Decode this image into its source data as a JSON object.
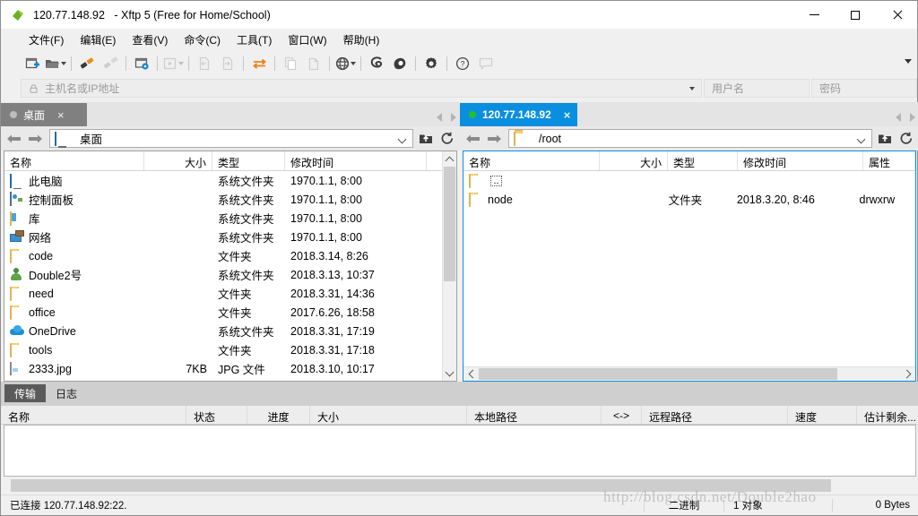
{
  "window": {
    "title_host": "120.77.148.92",
    "title_app": "- Xftp 5 (Free for Home/School)",
    "minimize_label": "—",
    "maximize_label": "□",
    "close_label": "✕"
  },
  "menu": [
    {
      "label": "文件(F)"
    },
    {
      "label": "编辑(E)"
    },
    {
      "label": "查看(V)"
    },
    {
      "label": "命令(C)"
    },
    {
      "label": "工具(T)"
    },
    {
      "label": "窗口(W)"
    },
    {
      "label": "帮助(H)"
    }
  ],
  "toolbar": {
    "buttons": [
      {
        "icon": "new-session-icon",
        "enabled": true
      },
      {
        "icon": "open-folder-icon",
        "enabled": true,
        "dropdown": true
      },
      {
        "icon": "connect-icon",
        "enabled": true
      },
      {
        "icon": "disconnect-icon",
        "enabled": false
      },
      {
        "icon": "session-manager-icon",
        "enabled": true
      },
      {
        "icon": "run-icon",
        "enabled": false,
        "dropdown": true
      },
      {
        "icon": "transfer-left-icon",
        "enabled": false
      },
      {
        "icon": "transfer-right-icon",
        "enabled": false
      },
      {
        "icon": "sync-browse-icon",
        "enabled": true
      },
      {
        "icon": "copy-icon",
        "enabled": false
      },
      {
        "icon": "paste-icon",
        "enabled": false
      },
      {
        "icon": "globe-icon",
        "enabled": true,
        "dropdown": true
      },
      {
        "icon": "xshell-icon",
        "enabled": true
      },
      {
        "icon": "xmanager-icon",
        "enabled": true
      },
      {
        "icon": "gear-icon",
        "enabled": true
      },
      {
        "icon": "help-icon",
        "enabled": true
      },
      {
        "icon": "feedback-icon",
        "enabled": false
      }
    ]
  },
  "address_bar": {
    "host_placeholder": "主机名或IP地址",
    "host_value": "",
    "username_placeholder": "用户名",
    "username_value": "",
    "password_placeholder": "密码",
    "password_value": ""
  },
  "left_pane": {
    "tab": {
      "label": "桌面",
      "status": "disconnected",
      "close": "×"
    },
    "path": "桌面",
    "columns": [
      "名称",
      "大小",
      "类型",
      "修改时间"
    ],
    "sort_column": 0,
    "sort_dir": "asc",
    "rows": [
      {
        "icon": "computer-icon",
        "name": "此电脑",
        "size": "",
        "type": "系统文件夹",
        "modified": "1970.1.1, 8:00"
      },
      {
        "icon": "control-panel-icon",
        "name": "控制面板",
        "size": "",
        "type": "系统文件夹",
        "modified": "1970.1.1, 8:00"
      },
      {
        "icon": "library-icon",
        "name": "库",
        "size": "",
        "type": "系统文件夹",
        "modified": "1970.1.1, 8:00"
      },
      {
        "icon": "network-icon",
        "name": "网络",
        "size": "",
        "type": "系统文件夹",
        "modified": "1970.1.1, 8:00"
      },
      {
        "icon": "folder-icon",
        "name": "code",
        "size": "",
        "type": "文件夹",
        "modified": "2018.3.14, 8:26"
      },
      {
        "icon": "user-icon",
        "name": "Double2号",
        "size": "",
        "type": "系统文件夹",
        "modified": "2018.3.13, 10:37"
      },
      {
        "icon": "folder-icon",
        "name": "need",
        "size": "",
        "type": "文件夹",
        "modified": "2018.3.31, 14:36"
      },
      {
        "icon": "folder-icon",
        "name": "office",
        "size": "",
        "type": "文件夹",
        "modified": "2017.6.26, 18:58"
      },
      {
        "icon": "onedrive-icon",
        "name": "OneDrive",
        "size": "",
        "type": "系统文件夹",
        "modified": "2018.3.31, 17:19"
      },
      {
        "icon": "folder-icon",
        "name": "tools",
        "size": "",
        "type": "文件夹",
        "modified": "2018.3.31, 17:18"
      },
      {
        "icon": "jpg-icon",
        "name": "2333.jpg",
        "size": "7KB",
        "type": "JPG 文件",
        "modified": "2018.3.10, 10:17"
      }
    ]
  },
  "right_pane": {
    "tab": {
      "label": "120.77.148.92",
      "status": "connected",
      "close": "×"
    },
    "path": "/root",
    "columns": [
      "名称",
      "大小",
      "类型",
      "修改时间",
      "属性"
    ],
    "sort_column": 0,
    "sort_dir": "asc",
    "rows": [
      {
        "icon": "folder-icon",
        "name": "..",
        "size": "",
        "type": "",
        "modified": "",
        "attrs": "",
        "selected": true
      },
      {
        "icon": "folder-icon",
        "name": "node",
        "size": "",
        "type": "文件夹",
        "modified": "2018.3.20, 8:46",
        "attrs": "drwxrw",
        "selected": false
      }
    ]
  },
  "transfer_panel": {
    "tabs": [
      {
        "label": "传输",
        "active": true
      },
      {
        "label": "日志",
        "active": false
      }
    ],
    "columns": [
      "名称",
      "状态",
      "进度",
      "大小",
      "本地路径",
      "<->",
      "远程路径",
      "速度",
      "估计剩余..."
    ],
    "rows": []
  },
  "status_bar": {
    "connection": "已连接 120.77.148.92:22.",
    "mode": "二进制",
    "object_count": "1 对象",
    "bytes": "0 Bytes"
  },
  "watermark": {
    "text": "http://blog.csdn.net/Double2hao"
  },
  "colors": {
    "accent": "#0a8fe0",
    "connected_dot": "#22c12a",
    "disconnected_dot": "#bdbdbd",
    "inactive_tab": "#808080",
    "folder": "#f6d173"
  }
}
